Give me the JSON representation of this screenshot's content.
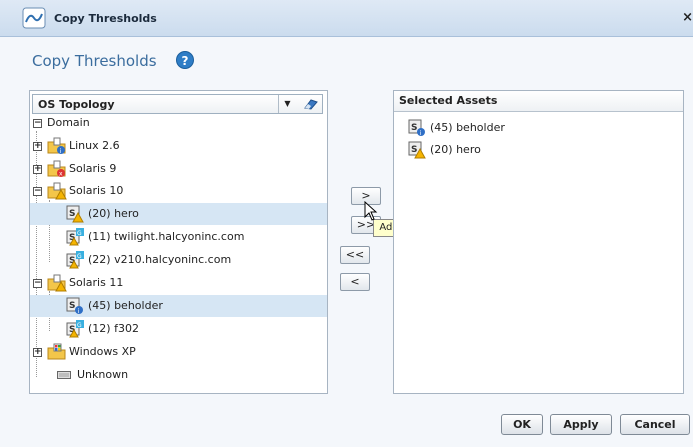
{
  "window": {
    "title": "Copy Thresholds",
    "close_glyph": "×"
  },
  "heading": "Copy Thresholds",
  "help_glyph": "?",
  "left_panel": {
    "header": "OS Topology",
    "dropdown_glyph": "▼",
    "tree": [
      {
        "label": "Domain",
        "expander": "⊟",
        "icon": "none"
      },
      {
        "label": "Linux 2.6",
        "expander": "+",
        "icon": "folder-info-icon"
      },
      {
        "label": "Solaris 9",
        "expander": "+",
        "icon": "folder-error-icon"
      },
      {
        "label": "Solaris 10",
        "expander": "−",
        "icon": "folder-warning-icon"
      },
      {
        "label": "(20) hero",
        "icon": "server-warning-icon",
        "selected": true
      },
      {
        "label": "(11) twilight.halcyoninc.com",
        "icon": "server-ok-warning-icon"
      },
      {
        "label": "(22) v210.halcyoninc.com",
        "icon": "server-ok-warning-icon"
      },
      {
        "label": "Solaris 11",
        "expander": "−",
        "icon": "folder-warning-icon"
      },
      {
        "label": "(45) beholder",
        "icon": "server-info-icon",
        "selected": true
      },
      {
        "label": "(12) f302",
        "icon": "server-ok-warning-icon"
      },
      {
        "label": "Windows XP",
        "expander": "+",
        "icon": "folder-icon"
      },
      {
        "label": "Unknown",
        "icon": "keyboard-icon"
      }
    ]
  },
  "move_buttons": {
    "add": ">",
    "add_all": ">>",
    "remove_all": "<<",
    "remove": "<"
  },
  "tooltip": "Add",
  "right_panel": {
    "header": "Selected Assets",
    "items": [
      {
        "label": "(45) beholder",
        "icon": "server-info-icon"
      },
      {
        "label": "(20) hero",
        "icon": "server-warning-icon"
      }
    ]
  },
  "footer": {
    "ok": "OK",
    "apply": "Apply",
    "cancel": "Cancel"
  },
  "colors": {
    "accent": "#3b6d9e",
    "selection": "#d6e6f4",
    "titlebar": "#cbdcee"
  }
}
